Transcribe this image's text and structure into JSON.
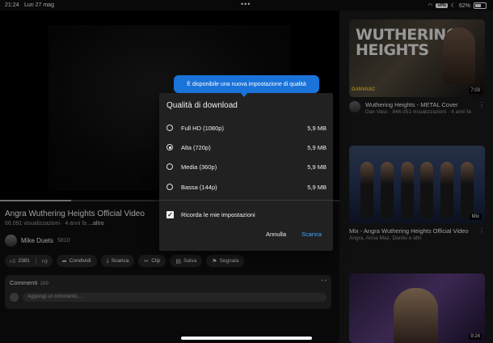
{
  "status_bar": {
    "time": "21:24",
    "date": "Lun 27 mag",
    "dots": "•••",
    "vpn": "VPN",
    "battery": "62%",
    "battery_level": 0.62
  },
  "player": {
    "progress": 0.21
  },
  "video": {
    "title": "Angra   Wuthering Heights Official Video",
    "views": "66.091 visualizzazioni · 4 anni fa",
    "more": "...altro"
  },
  "channel": {
    "name": "Mike Duets",
    "subs": "5810"
  },
  "actions": {
    "likes": "2381",
    "share": "Condividi",
    "download": "Scarica",
    "clip": "Clip",
    "save": "Salva",
    "report": "Segnala"
  },
  "comments": {
    "label": "Commenti",
    "count": "169",
    "indicator": "• •",
    "placeholder": "Aggiungi un commento..."
  },
  "tooltip": {
    "text": "È disponibile una nuova impostazione di qualità"
  },
  "dialog": {
    "title": "Qualità di download",
    "options": [
      {
        "label": "Full HD (1080p)",
        "size": "5,9 MB",
        "selected": false
      },
      {
        "label": "Alta (720p)",
        "size": "5,9 MB",
        "selected": true
      },
      {
        "label": "Media (360p)",
        "size": "5,9 MB",
        "selected": false
      },
      {
        "label": "Bassa (144p)",
        "size": "5,9 MB",
        "selected": false
      }
    ],
    "remember": "Ricorda le mie impostazioni",
    "cancel": "Annulla",
    "download": "Scarica"
  },
  "recommendations": [
    {
      "thumb_text_1": "WUTHERING",
      "thumb_text_2": "HEIGHTS",
      "thumb_logo": "DANVASC",
      "duration": "7:03",
      "title": "Wuthering Heights - METAL Cover",
      "meta": "Dan Vasc · 846.051 visualizzazioni · 4 anni fa"
    },
    {
      "badge": "Mix",
      "title": "Mix - Angra   Wuthering Heights Official Video",
      "meta": "Angra, Anna Maz, Danilu e altri"
    },
    {
      "duration": "9:24"
    }
  ]
}
